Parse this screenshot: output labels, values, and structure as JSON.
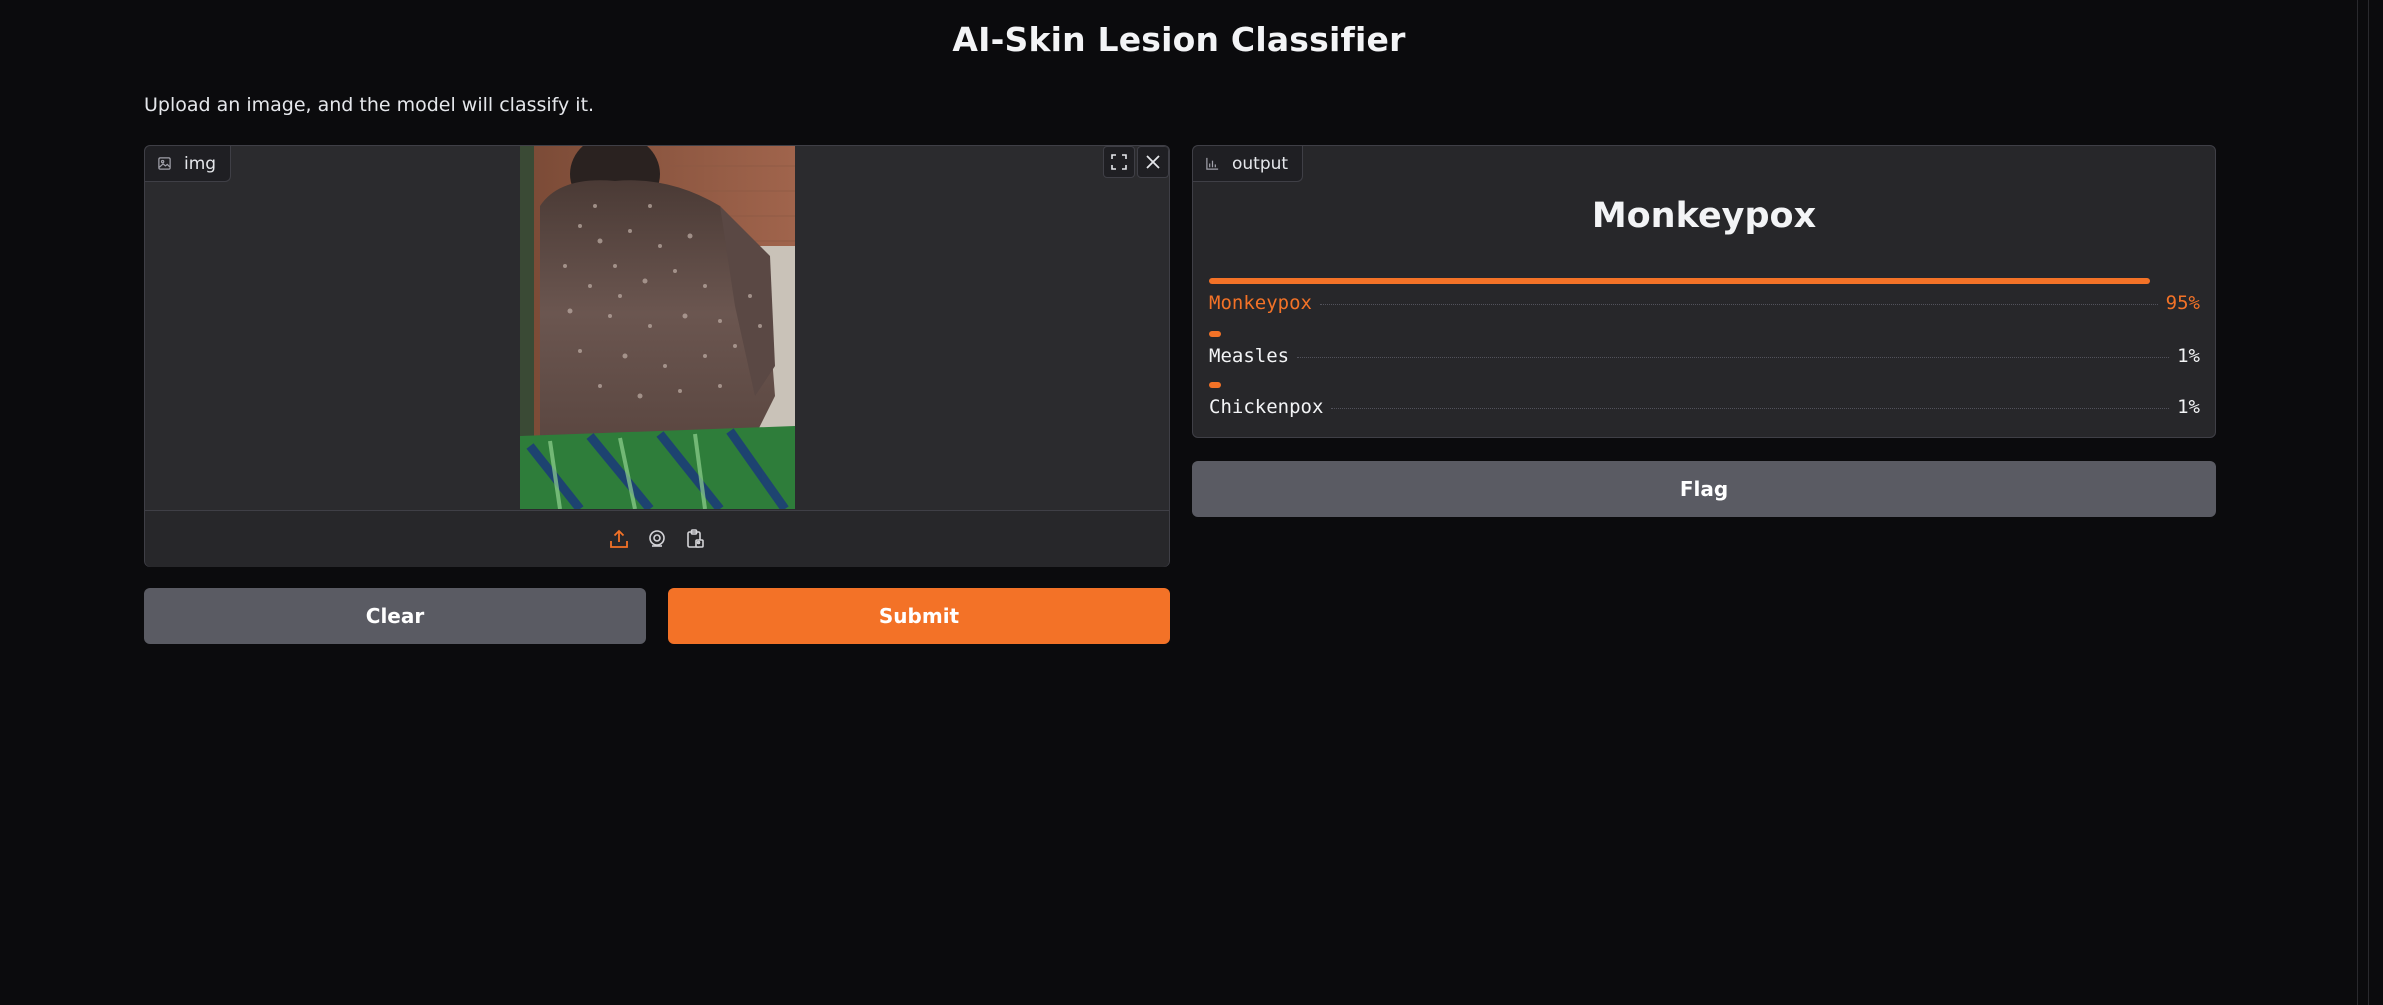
{
  "app": {
    "title": "AI-Skin Lesion Classifier",
    "description": "Upload an image, and the model will classify it."
  },
  "input_panel": {
    "label": "img",
    "icons": [
      "image-icon",
      "fullscreen-icon",
      "close-icon",
      "upload-icon",
      "webcam-icon",
      "clipboard-icon"
    ]
  },
  "buttons": {
    "clear": "Clear",
    "submit": "Submit",
    "flag": "Flag"
  },
  "output_panel": {
    "label": "output",
    "top_label": "Monkeypox",
    "confidences": [
      {
        "label": "Monkeypox",
        "value_text": "95%",
        "fraction": 0.95
      },
      {
        "label": "Measles",
        "value_text": "1%",
        "fraction": 0.01
      },
      {
        "label": "Chickenpox",
        "value_text": "1%",
        "fraction": 0.01
      }
    ]
  },
  "colors": {
    "accent": "#f37227",
    "background": "#0b0b0d",
    "panel": "#27272a",
    "secondary_button": "#5a5b63"
  }
}
